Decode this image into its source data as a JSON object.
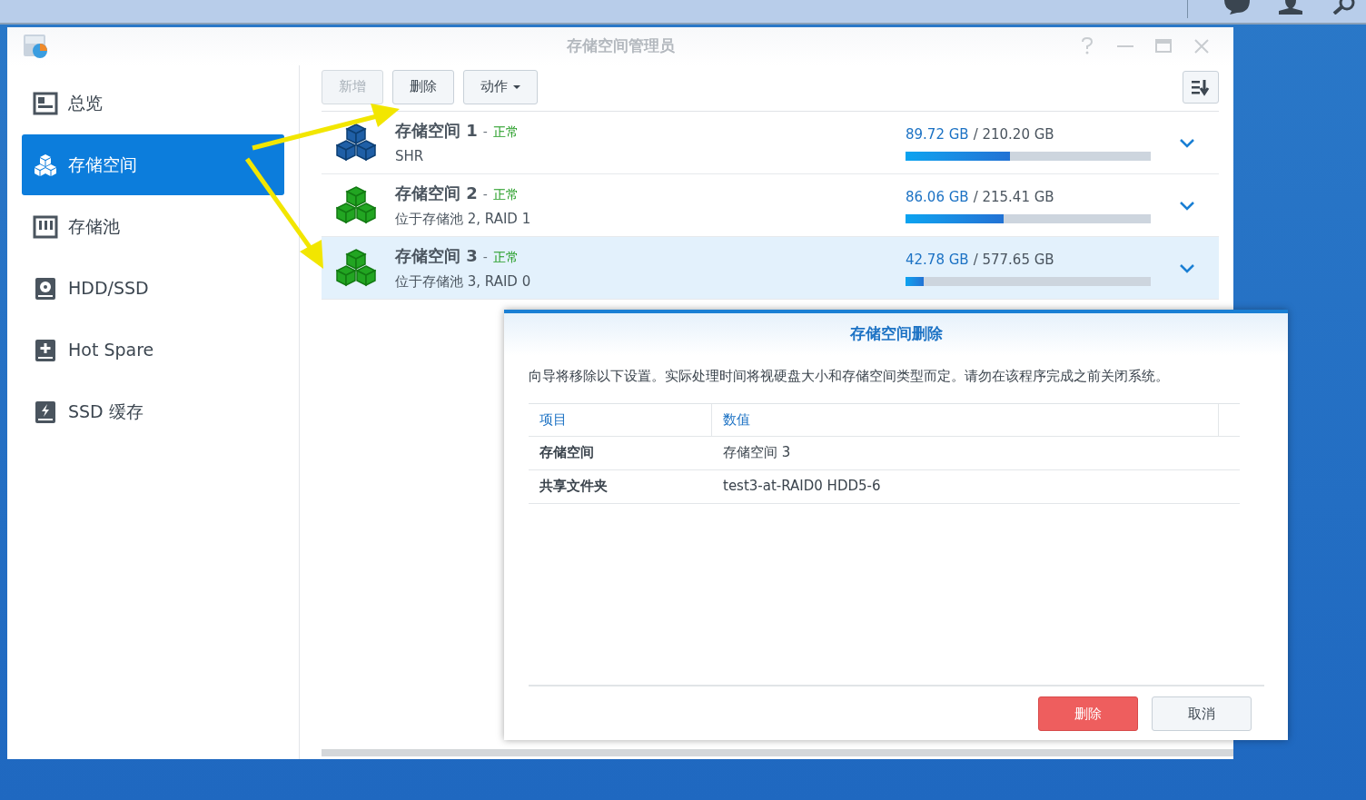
{
  "window": {
    "title": "存储空间管理员"
  },
  "sidebar": {
    "items": [
      {
        "label": "总览",
        "kind": "overview",
        "selected": false
      },
      {
        "label": "存储空间",
        "kind": "volume",
        "selected": true
      },
      {
        "label": "存储池",
        "kind": "pool",
        "selected": false
      },
      {
        "label": "HDD/SSD",
        "kind": "disk",
        "selected": false
      },
      {
        "label": "Hot Spare",
        "kind": "spare",
        "selected": false
      },
      {
        "label": "SSD 缓存",
        "kind": "cache",
        "selected": false
      }
    ]
  },
  "toolbar": {
    "buttons": [
      {
        "label": "新增",
        "disabled": true,
        "dropdown": false
      },
      {
        "label": "删除",
        "disabled": false,
        "dropdown": false
      },
      {
        "label": "动作",
        "disabled": false,
        "dropdown": true
      }
    ]
  },
  "volumes": [
    {
      "name": "存储空间 1",
      "dash": "-",
      "status": "正常",
      "detail": "SHR",
      "used": "89.72 GB",
      "total": "/ 210.20 GB",
      "level": 0.427,
      "color": "#1f5fa6",
      "selected": false
    },
    {
      "name": "存储空间 2",
      "dash": "-",
      "status": "正常",
      "detail": "位于存储池 2, RAID 1",
      "used": "86.06 GB",
      "total": "/ 215.41 GB",
      "level": 0.4,
      "color": "#22a522",
      "selected": false
    },
    {
      "name": "存储空间 3",
      "dash": "-",
      "status": "正常",
      "detail": "位于存储池 3, RAID 0",
      "used": "42.78 GB",
      "total": "/ 577.65 GB",
      "level": 0.074,
      "color": "#22a522",
      "selected": true
    }
  ],
  "dialog": {
    "title": "存储空间删除",
    "message": "向导将移除以下设置。实际处理时间将视硬盘大小和存储空间类型而定。请勿在该程序完成之前关闭系统。",
    "table": {
      "columns": [
        "项目",
        "数值"
      ],
      "rows": [
        [
          "存储空间",
          "存储空间 3"
        ],
        [
          "共享文件夹",
          "test3-at-RAID0 HDD5-6"
        ]
      ]
    },
    "buttons": [
      {
        "label": "删除",
        "kind": "danger"
      },
      {
        "label": "取消",
        "kind": "plain"
      }
    ]
  }
}
